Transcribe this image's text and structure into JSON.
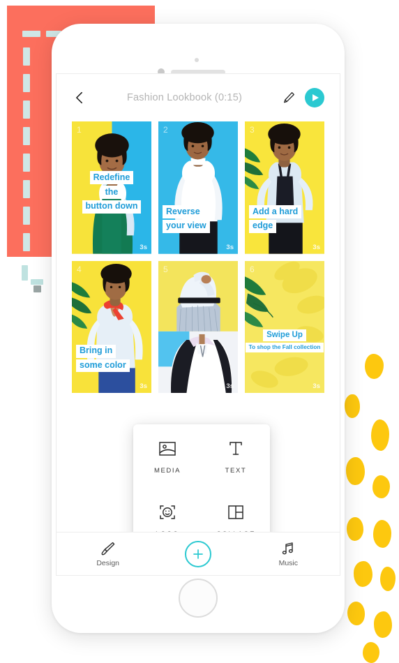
{
  "app": {
    "header": {
      "back_icon": "chevron-left-icon",
      "title": "Fashion Lookbook (0:15)",
      "edit_icon": "pencil-icon",
      "play_icon": "play-icon"
    },
    "cards": [
      {
        "index": "1",
        "duration": "3s",
        "lines": [
          "Redefine",
          "the",
          "button down"
        ],
        "align": "center",
        "bg_left": "#f7e33a",
        "bg_right": "#2bb6e8"
      },
      {
        "index": "2",
        "duration": "3s",
        "lines": [
          "Reverse",
          "your view"
        ],
        "align": "left",
        "bg_left": "#31b6e6",
        "bg_right": "#31b6e6"
      },
      {
        "index": "3",
        "duration": "3s",
        "lines": [
          "Add a hard",
          "edge"
        ],
        "align": "left",
        "bg_left": "#f9e53c",
        "bg_right": "#f9e53c"
      },
      {
        "index": "4",
        "duration": "3s",
        "lines": [
          "Bring in",
          "some color"
        ],
        "align": "left",
        "bg_left": "#f8e23a",
        "bg_right": "#f8e23a"
      },
      {
        "index": "5",
        "duration": "3s",
        "lines": [],
        "align": "left",
        "bg_left": "#f3e45c",
        "bg_right": "#f3e45c"
      },
      {
        "index": "6",
        "duration": "3s",
        "lines": [
          "Swipe Up",
          "To shop the Fall collection"
        ],
        "align": "center",
        "bg_left": "#f5e65e",
        "bg_right": "#f5e65e"
      }
    ],
    "popup": {
      "items": [
        {
          "label": "MEDIA",
          "icon": "media-image-icon"
        },
        {
          "label": "TEXT",
          "icon": "text-t-icon"
        },
        {
          "label": "LOGO",
          "icon": "logo-smiley-icon"
        },
        {
          "label": "COLLAGE",
          "icon": "collage-grid-icon"
        }
      ]
    },
    "bottom_bar": {
      "design_label": "Design",
      "design_icon": "brush-icon",
      "add_icon": "plus-icon",
      "music_label": "Music",
      "music_icon": "music-note-icon"
    },
    "colors": {
      "accent_teal": "#2bc9d1",
      "caption_blue": "#1f9cd8",
      "deco_coral": "#fc6f5d",
      "deco_yellow": "#fdc80f",
      "deco_dash": "#cfe7e6"
    }
  }
}
